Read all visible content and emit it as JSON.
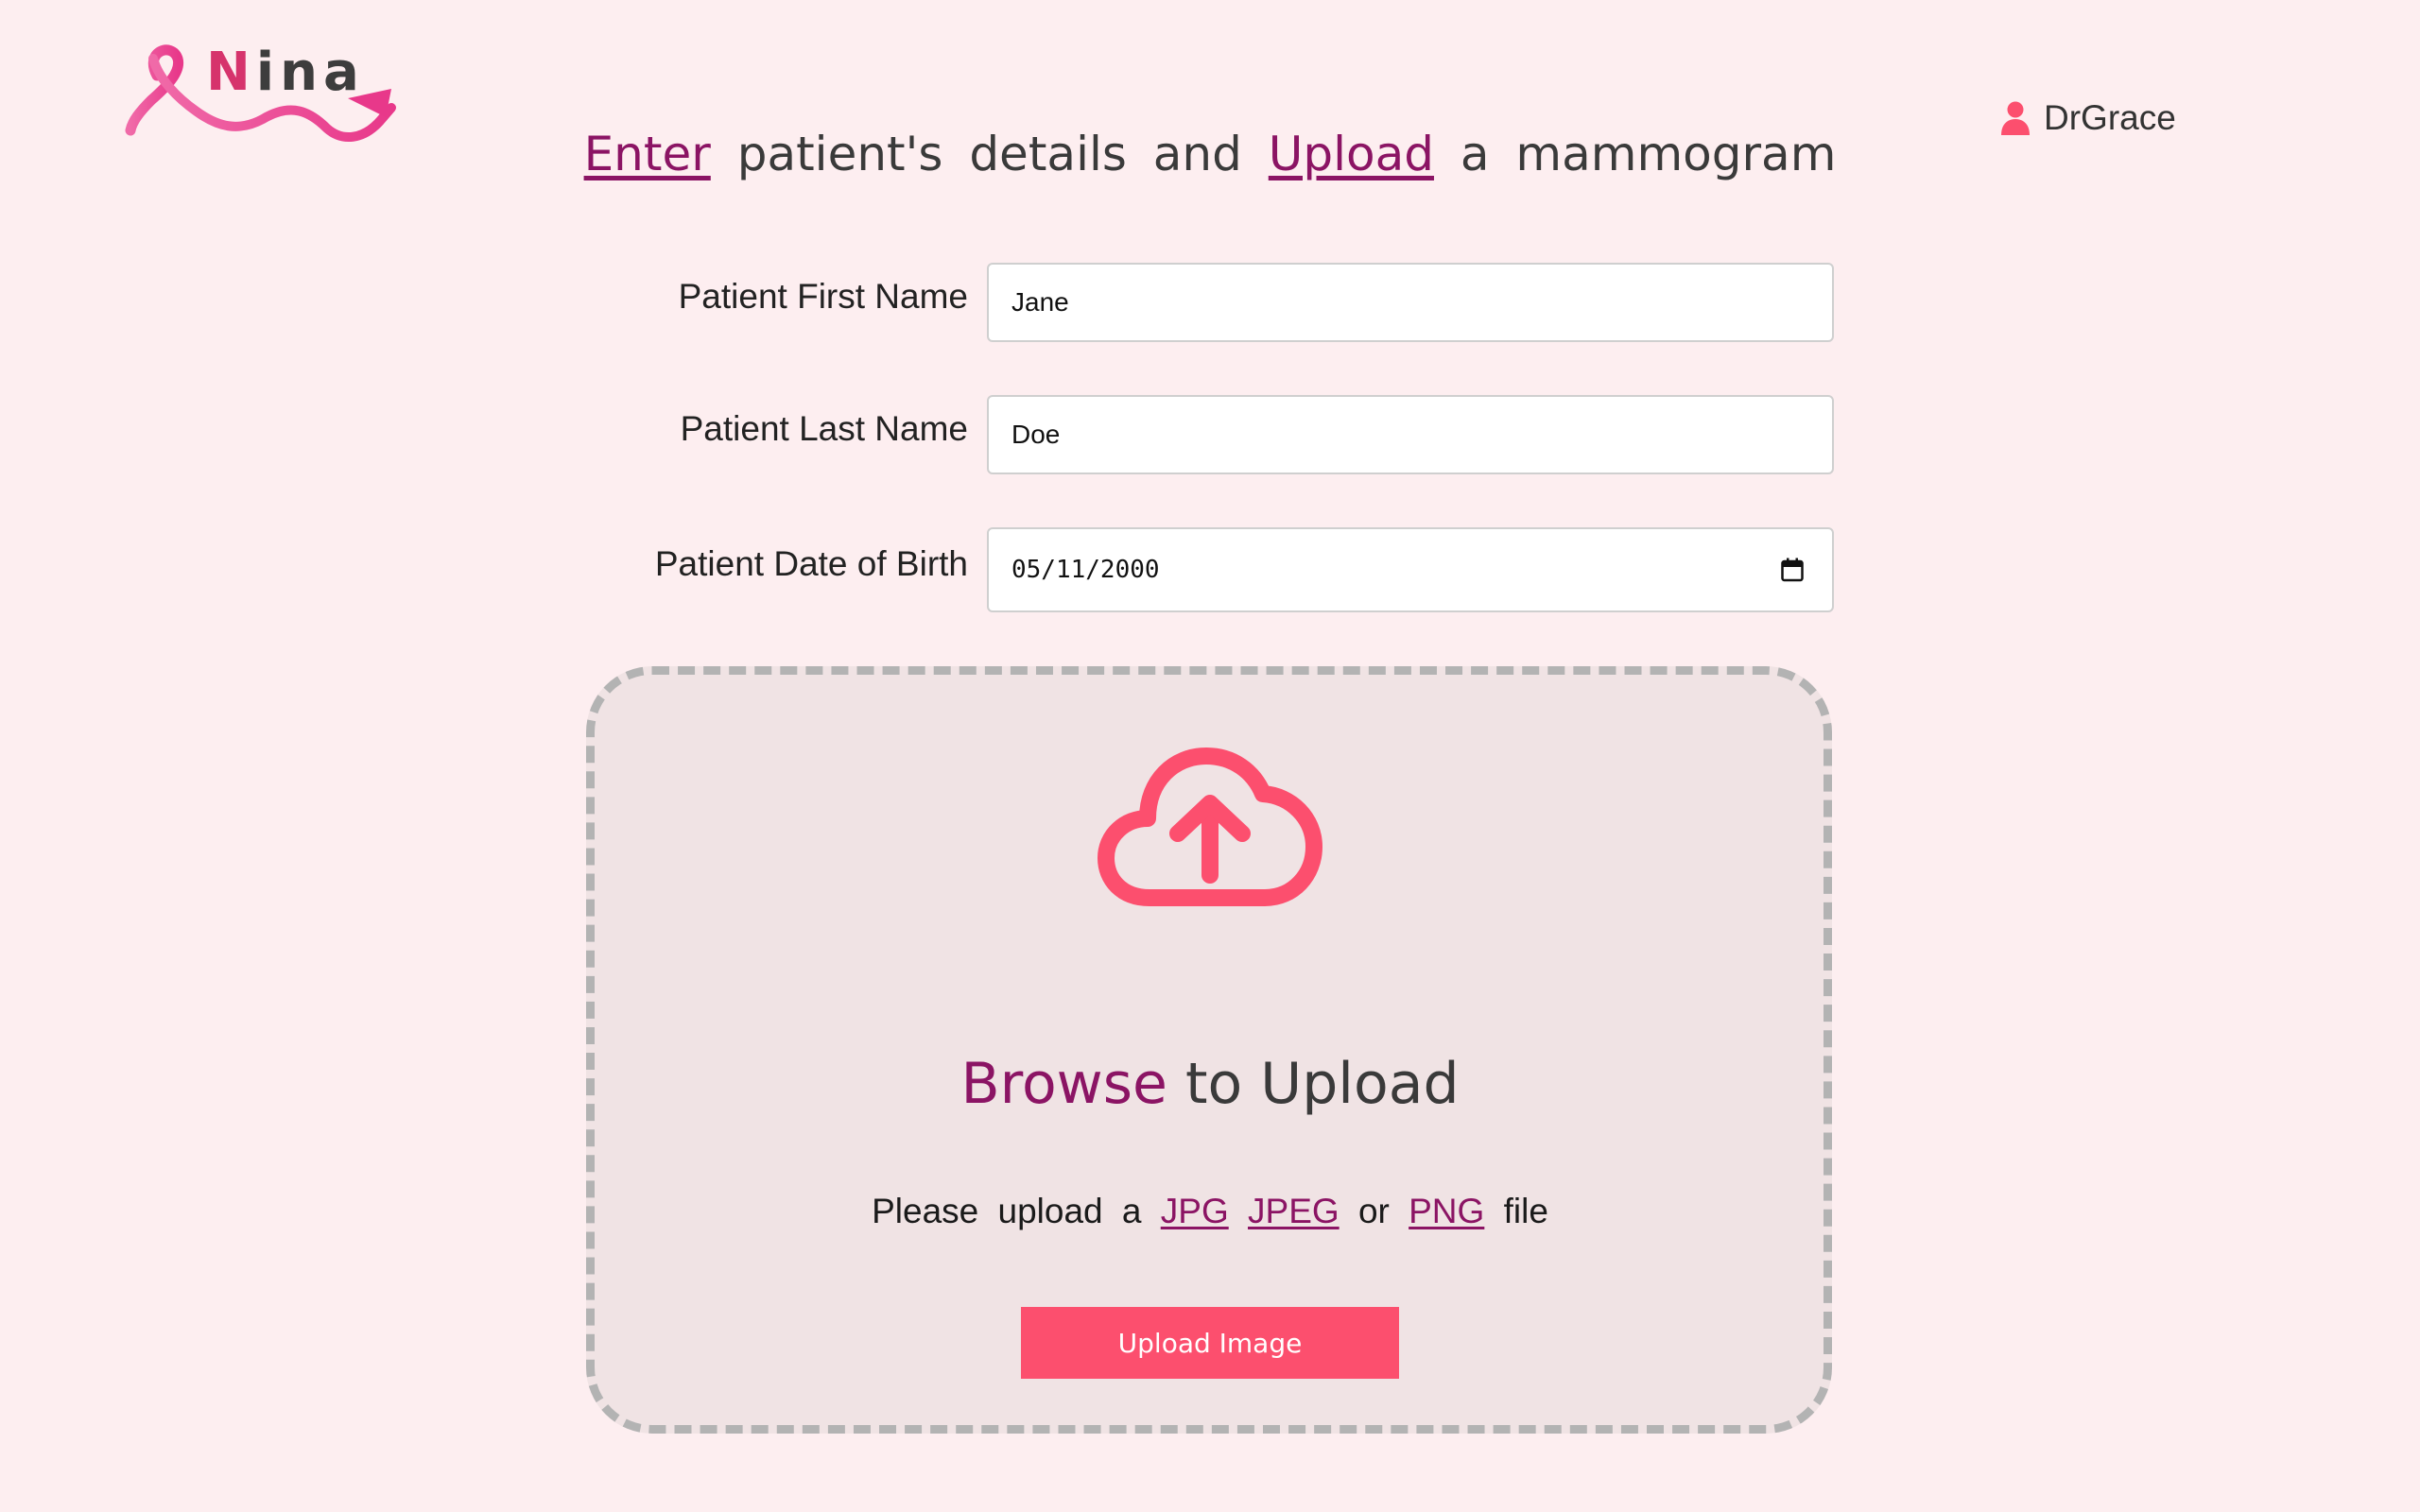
{
  "app": {
    "logo_text_first": "N",
    "logo_text_rest": "ina"
  },
  "user": {
    "name": "DrGrace",
    "icon": "user-icon"
  },
  "heading": {
    "link_enter": "Enter",
    "text_1": "patient's details and",
    "link_upload": "Upload",
    "text_2": "a mammogram"
  },
  "form": {
    "first_name_label": "Patient First Name",
    "first_name_value": "Jane",
    "last_name_label": "Patient Last Name",
    "last_name_value": "Doe",
    "dob_label": "Patient Date of Birth",
    "dob_value": "05/11/2000",
    "dob_icon": "calendar-icon"
  },
  "upload": {
    "icon": "cloud-upload-icon",
    "browse_label": "Browse",
    "browse_suffix": "to Upload",
    "hint_prefix": "Please upload a",
    "format_jpg": "JPG",
    "format_jpeg": "JPEG",
    "hint_or": "or",
    "format_png": "PNG",
    "hint_suffix": "file",
    "button_label": "Upload Image"
  },
  "colors": {
    "background": "#fdeef0",
    "accent": "#fc4f6e",
    "link": "#8b1464",
    "dropzone_bg": "#f0e3e4",
    "dropzone_border": "#b3b3b3"
  }
}
